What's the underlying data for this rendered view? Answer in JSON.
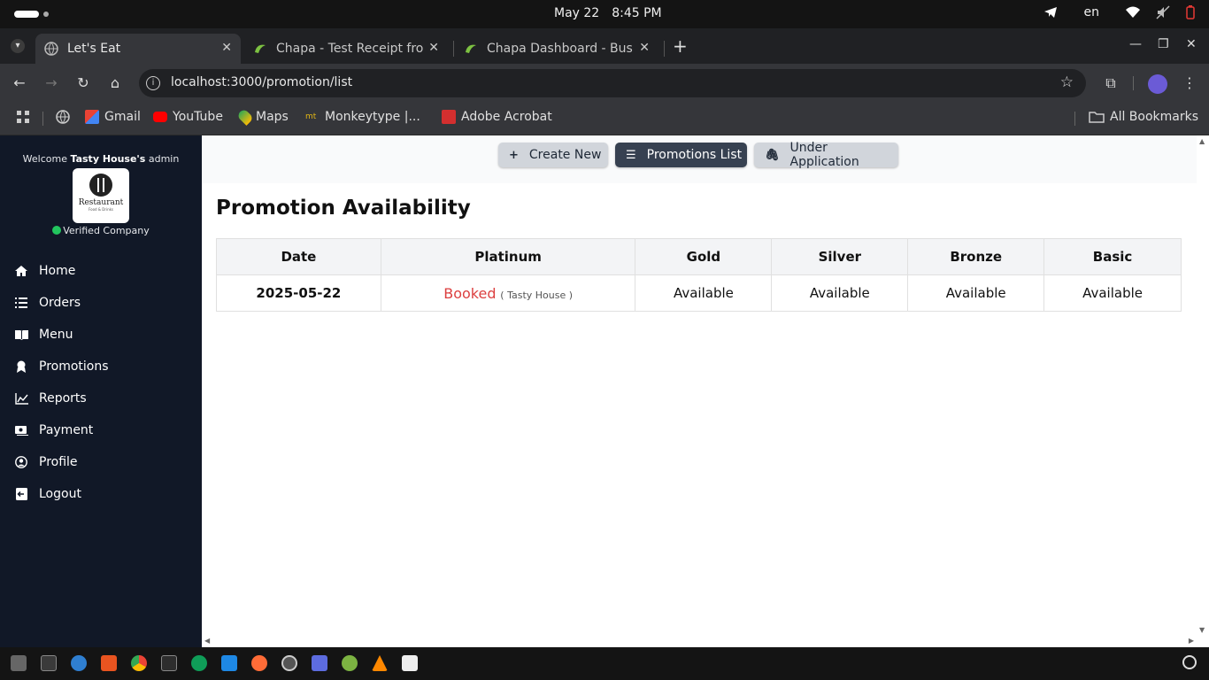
{
  "os": {
    "date": "May 22",
    "time": "8:45 PM",
    "lang": "en"
  },
  "browser": {
    "tabs": [
      {
        "title": "Let's Eat",
        "active": true
      },
      {
        "title": "Chapa - Test Receipt from",
        "active": false
      },
      {
        "title": "Chapa Dashboard - Business",
        "active": false
      }
    ],
    "url": "localhost:3000/promotion/list",
    "bookmarks": [
      "Gmail",
      "YouTube",
      "Maps",
      "Monkeytype |...",
      "Adobe Acrobat"
    ],
    "all_bookmarks": "All Bookmarks"
  },
  "sidebar": {
    "welcome_prefix": "Welcome",
    "restaurant_name": "Tasty House's",
    "welcome_suffix": "admin",
    "logo_text": "Restaurant",
    "logo_sub": "Food & Drinks",
    "verified": "Verified Company",
    "items": [
      {
        "label": "Home",
        "icon": "home-icon"
      },
      {
        "label": "Orders",
        "icon": "list-icon"
      },
      {
        "label": "Menu",
        "icon": "book-icon"
      },
      {
        "label": "Promotions",
        "icon": "ribbon-icon"
      },
      {
        "label": "Reports",
        "icon": "chart-line-icon"
      },
      {
        "label": "Payment",
        "icon": "money-icon"
      },
      {
        "label": "Profile",
        "icon": "user-circle-icon"
      },
      {
        "label": "Logout",
        "icon": "logout-icon"
      }
    ]
  },
  "toolbar": {
    "create_new": "Create New",
    "promotions_list": "Promotions List",
    "under_application": "Under Application"
  },
  "page": {
    "title": "Promotion Availability"
  },
  "table": {
    "headers": [
      "Date",
      "Platinum",
      "Gold",
      "Silver",
      "Bronze",
      "Basic"
    ],
    "rows": [
      {
        "date": "2025-05-22",
        "platinum_status": "Booked",
        "platinum_by": "( Tasty House )",
        "gold": "Available",
        "silver": "Available",
        "bronze": "Available",
        "basic": "Available"
      }
    ]
  },
  "colors": {
    "sidebar_bg": "#111827",
    "booked": "#dc3f3f",
    "available": "#22c55e",
    "active_button": "#374151"
  }
}
